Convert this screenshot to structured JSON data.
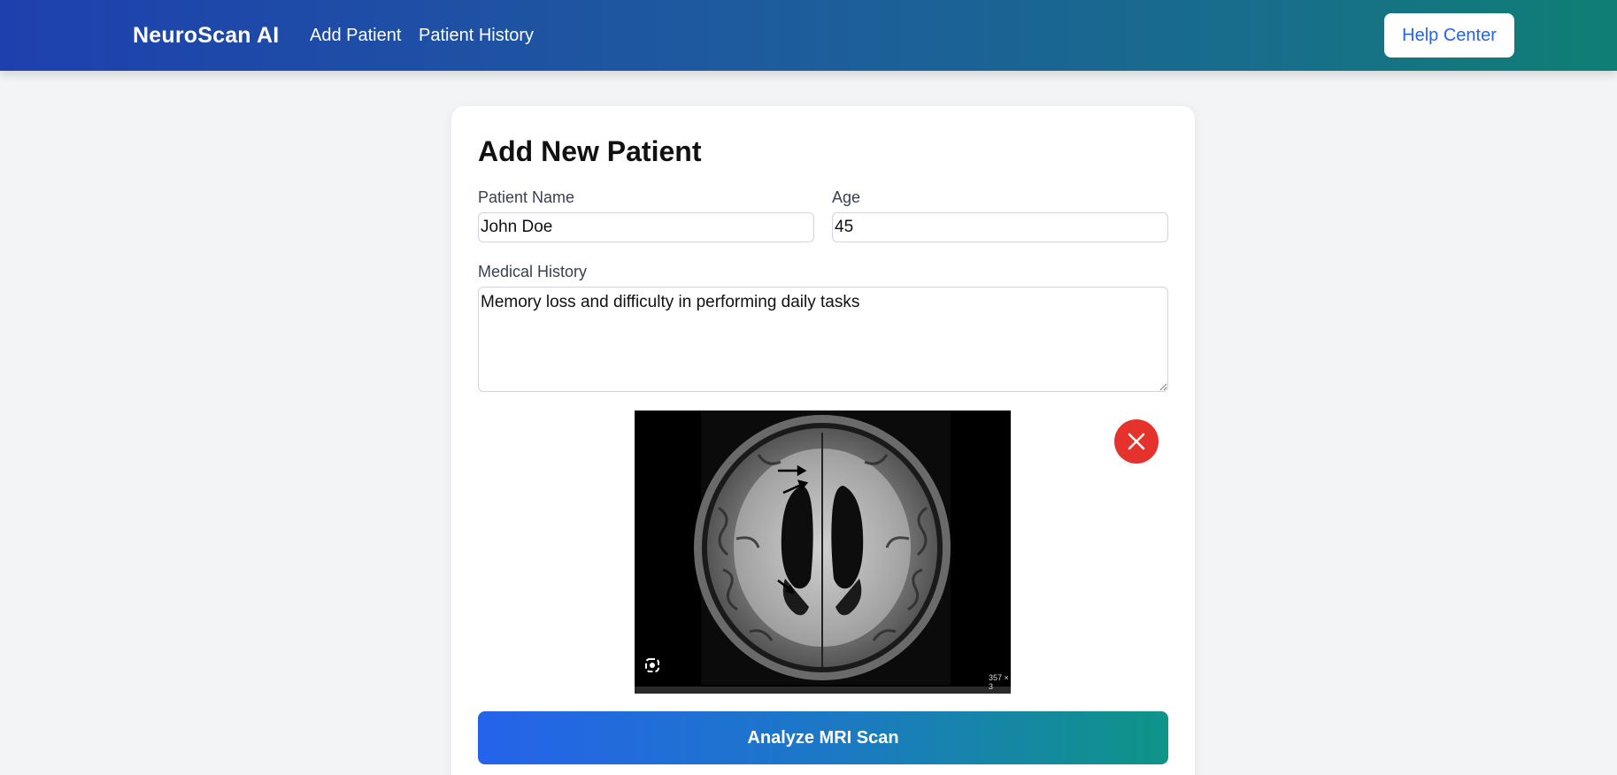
{
  "header": {
    "brand": "NeuroScan AI",
    "nav": [
      "Add Patient",
      "Patient History"
    ],
    "help_label": "Help Center"
  },
  "form": {
    "title": "Add New Patient",
    "name_label": "Patient Name",
    "name_value": "John Doe",
    "age_label": "Age",
    "age_value": "45",
    "history_label": "Medical History",
    "history_value": "Memory loss and difficulty in performing daily tasks",
    "image_dims": "357 × 3",
    "analyze_label": "Analyze MRI Scan"
  },
  "icons": {
    "remove": "close-icon",
    "lens": "google-lens-icon"
  },
  "colors": {
    "header_start": "#1e40af",
    "header_end": "#0f7f74",
    "remove_button": "#e5322d",
    "analyze_start": "#2563eb",
    "analyze_end": "#0f9488",
    "help_text": "#2563eb"
  }
}
